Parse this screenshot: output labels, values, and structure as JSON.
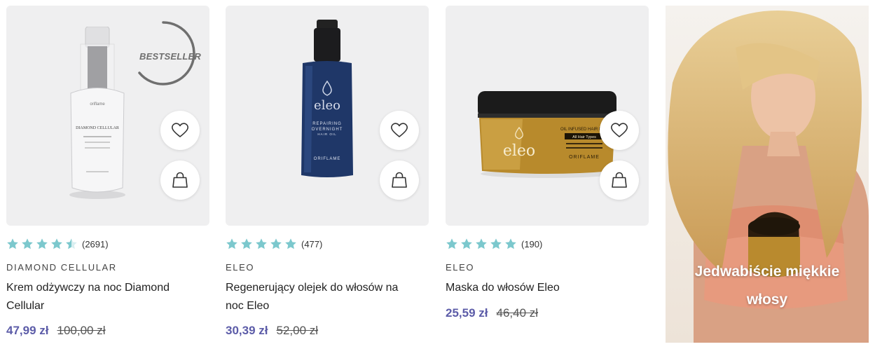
{
  "products": [
    {
      "brand": "DIAMOND CELLULAR",
      "name": "Krem odżywczy na noc Diamond Cellular",
      "rating": 4.5,
      "rating_count": "(2691)",
      "price": "47,99 zł",
      "old_price": "100,00 zł",
      "badge": "BESTSELLER",
      "pack_text": {
        "brand": "oriflame",
        "line": "DIAMOND CELLULAR"
      }
    },
    {
      "brand": "ELEO",
      "name": "Regenerujący olejek do włosów na noc Eleo",
      "rating": 5,
      "rating_count": "(477)",
      "price": "30,39 zł",
      "old_price": "52,00 zł",
      "pack_text": {
        "brand": "eleo",
        "line1": "REPAIRING",
        "line2": "OVERNIGHT",
        "line3": "HAIR OIL",
        "maker": "ORIFLAME"
      }
    },
    {
      "brand": "ELEO",
      "name": "Maska do włosów Eleo",
      "rating": 5,
      "rating_count": "(190)",
      "price": "25,59 zł",
      "old_price": "46,40 zł",
      "pack_text": {
        "brand": "eleo",
        "line1": "OIL INFUSED HAIR MASK",
        "line2": "All Hair Types",
        "maker": "ORIFLAME"
      }
    }
  ],
  "promo": {
    "line1": "Jedwabiście miękkie",
    "line2": "włosy"
  },
  "colors": {
    "star": "#7cc8cd",
    "star_empty": "#d8eef0",
    "price": "#5c5ca8",
    "card_bg": "#efeff0"
  },
  "icons": {
    "wishlist": "heart-icon",
    "add_to_bag": "shopping-bag-icon",
    "rating": "star-icon"
  }
}
